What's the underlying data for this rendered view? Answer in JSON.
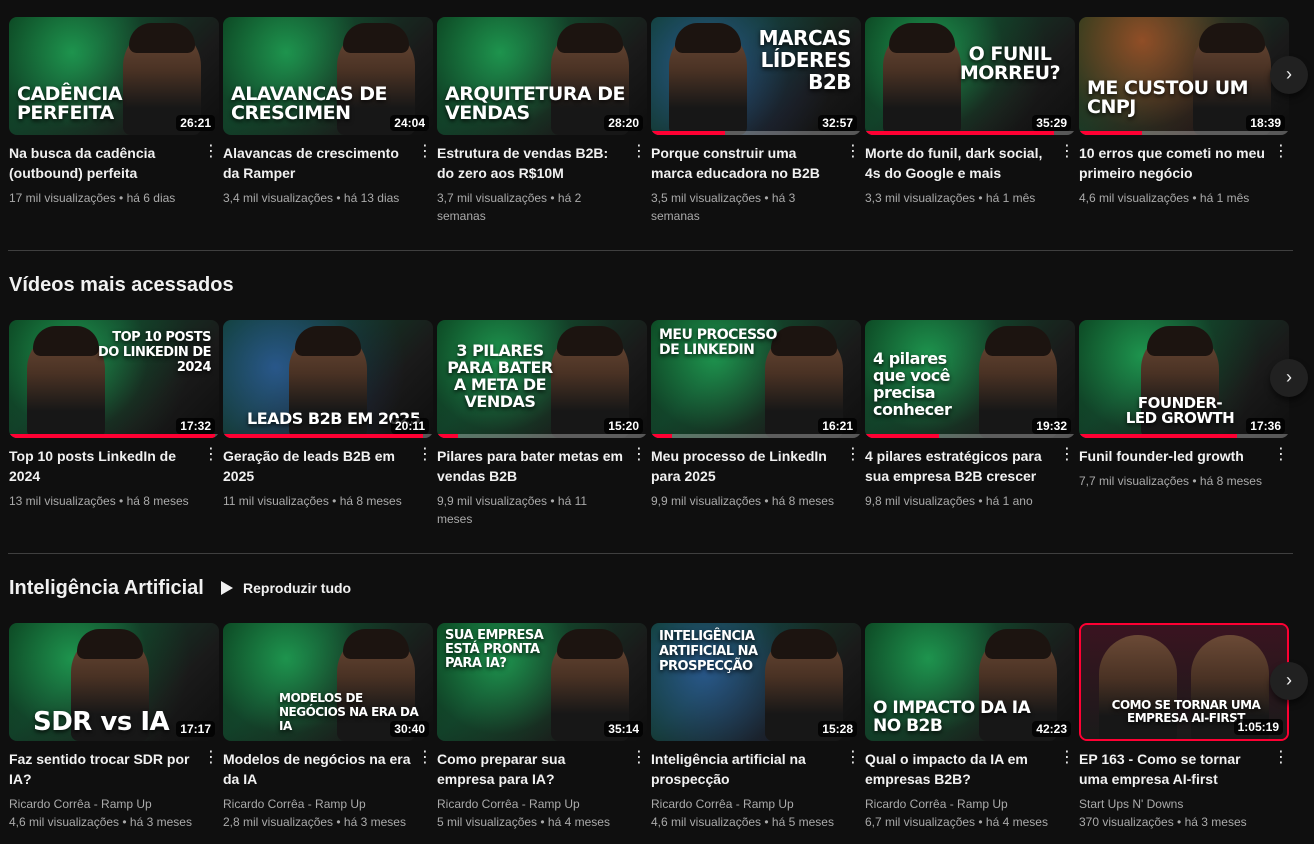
{
  "shelves": {
    "recent": {
      "videos": [
        {
          "thumb_text": "CADÊNCIA PERFEITA",
          "duration": "26:21",
          "title": "Na busca da cadência (outbound) perfeita",
          "stats": "17 mil visualizações • há 6 dias"
        },
        {
          "thumb_text": "ALAVANCAS DE CRESCIMEN",
          "duration": "24:04",
          "title": "Alavancas de crescimento da Ramper",
          "stats": "3,4 mil visualizações • há 13 dias"
        },
        {
          "thumb_text": "ARQUITETURA DE VENDAS",
          "duration": "28:20",
          "title": "Estrutura de vendas B2B: do zero aos R$10M",
          "stats": "3,7 mil visualizações • há 2 semanas"
        },
        {
          "thumb_text": "MARCAS LÍDERES B2B",
          "duration": "32:57",
          "title": "Porque construir uma marca educadora no B2B",
          "stats": "3,5 mil visualizações • há 3 semanas"
        },
        {
          "thumb_text": "O FUNIL MORREU?",
          "duration": "35:29",
          "title": "Morte do funil, dark social, 4s do Google e mais",
          "stats": "3,3 mil visualizações • há 1 mês"
        },
        {
          "thumb_text": "ME CUSTOU UM CNPJ",
          "duration": "18:39",
          "title": "10 erros que cometi no meu primeiro negócio",
          "stats": "4,6 mil visualizações • há 1 mês"
        }
      ]
    },
    "popular": {
      "title": "Vídeos mais acessados",
      "videos": [
        {
          "thumb_text": "TOP 10 POSTS DO LINKEDIN DE 2024",
          "duration": "17:32",
          "title": "Top 10 posts LinkedIn de 2024",
          "stats": "13 mil visualizações • há 8 meses"
        },
        {
          "thumb_text": "LEADS B2B EM 2025",
          "duration": "20:11",
          "title": "Geração de leads B2B em 2025",
          "stats": "11 mil visualizações • há 8 meses"
        },
        {
          "thumb_text": "3 PILARES PARA BATER A META DE VENDAS",
          "duration": "15:20",
          "title": "Pilares para bater metas em vendas B2B",
          "stats": "9,9 mil visualizações • há 11 meses"
        },
        {
          "thumb_text": "MEU PROCESSO DE LINKEDIN",
          "duration": "16:21",
          "title": "Meu processo de LinkedIn para 2025",
          "stats": "9,9 mil visualizações • há 8 meses"
        },
        {
          "thumb_text": "4 pilares que você precisa conhecer",
          "duration": "19:32",
          "title": "4 pilares estratégicos para sua empresa B2B crescer",
          "stats": "9,8 mil visualizações • há 1 ano"
        },
        {
          "thumb_text": "FOUNDER-LED GROWTH",
          "duration": "17:36",
          "title": "Funil founder-led growth",
          "stats": "7,7 mil visualizações • há 8 meses"
        }
      ]
    },
    "ai": {
      "title": "Inteligência Artificial",
      "play_all": "Reproduzir tudo",
      "videos": [
        {
          "thumb_text": "SDR vs IA",
          "duration": "17:17",
          "title": "Faz sentido trocar SDR por IA?",
          "channel": "Ricardo Corrêa - Ramp Up",
          "stats": "4,6 mil visualizações • há 3 meses"
        },
        {
          "thumb_text": "MODELOS DE NEGÓCIOS NA ERA DA IA",
          "duration": "30:40",
          "title": "Modelos de negócios na era da IA",
          "channel": "Ricardo Corrêa - Ramp Up",
          "stats": "2,8 mil visualizações • há 3 meses"
        },
        {
          "thumb_text": "SUA EMPRESA ESTÁ PRONTA PARA IA?",
          "duration": "35:14",
          "title": "Como preparar sua empresa para IA?",
          "channel": "Ricardo Corrêa - Ramp Up",
          "stats": "5 mil visualizações • há 4 meses"
        },
        {
          "thumb_text": "INTELIGÊNCIA ARTIFICIAL NA PROSPECÇÃO",
          "duration": "15:28",
          "title": "Inteligência artificial na prospecção",
          "channel": "Ricardo Corrêa - Ramp Up",
          "stats": "4,6 mil visualizações • há 5 meses"
        },
        {
          "thumb_text": "O IMPACTO DA IA NO B2B",
          "duration": "42:23",
          "title": "Qual o impacto da IA em empresas B2B?",
          "channel": "Ricardo Corrêa - Ramp Up",
          "stats": "6,7 mil visualizações • há 4 meses"
        },
        {
          "thumb_text": "COMO SE TORNAR UMA EMPRESA AI-FIRST",
          "duration": "1:05:19",
          "title": "EP 163 - Como se tornar uma empresa AI-first",
          "channel": "Start Ups N' Downs",
          "stats": "370 visualizações • há 3 meses"
        }
      ]
    }
  },
  "icons": {
    "next": "chevron-right-icon",
    "menu": "more-vert-icon",
    "play": "play-icon"
  },
  "colors": {
    "background": "#0f0f0f",
    "accent": "#ff0033",
    "secondary_text": "#aaaaaa"
  }
}
